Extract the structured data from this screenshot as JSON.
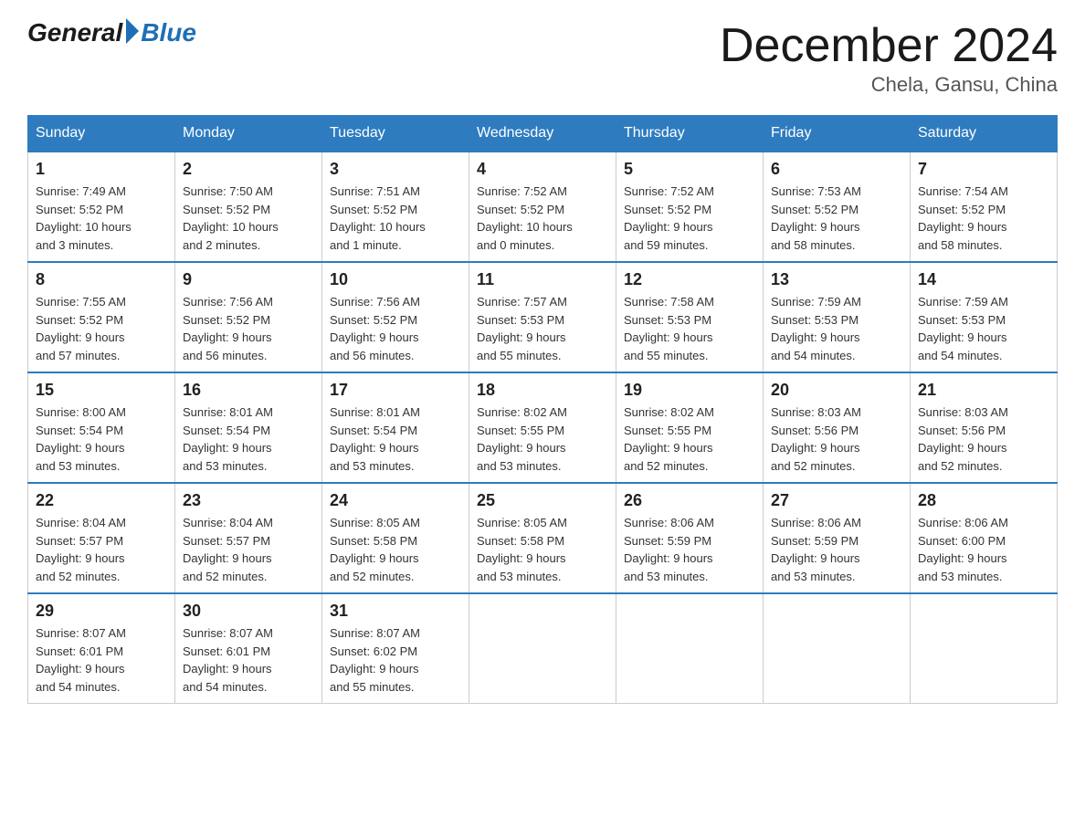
{
  "logo": {
    "general": "General",
    "blue": "Blue"
  },
  "title": "December 2024",
  "location": "Chela, Gansu, China",
  "weekdays": [
    "Sunday",
    "Monday",
    "Tuesday",
    "Wednesday",
    "Thursday",
    "Friday",
    "Saturday"
  ],
  "weeks": [
    [
      {
        "day": "1",
        "sunrise": "7:49 AM",
        "sunset": "5:52 PM",
        "daylight": "10 hours and 3 minutes."
      },
      {
        "day": "2",
        "sunrise": "7:50 AM",
        "sunset": "5:52 PM",
        "daylight": "10 hours and 2 minutes."
      },
      {
        "day": "3",
        "sunrise": "7:51 AM",
        "sunset": "5:52 PM",
        "daylight": "10 hours and 1 minute."
      },
      {
        "day": "4",
        "sunrise": "7:52 AM",
        "sunset": "5:52 PM",
        "daylight": "10 hours and 0 minutes."
      },
      {
        "day": "5",
        "sunrise": "7:52 AM",
        "sunset": "5:52 PM",
        "daylight": "9 hours and 59 minutes."
      },
      {
        "day": "6",
        "sunrise": "7:53 AM",
        "sunset": "5:52 PM",
        "daylight": "9 hours and 58 minutes."
      },
      {
        "day": "7",
        "sunrise": "7:54 AM",
        "sunset": "5:52 PM",
        "daylight": "9 hours and 58 minutes."
      }
    ],
    [
      {
        "day": "8",
        "sunrise": "7:55 AM",
        "sunset": "5:52 PM",
        "daylight": "9 hours and 57 minutes."
      },
      {
        "day": "9",
        "sunrise": "7:56 AM",
        "sunset": "5:52 PM",
        "daylight": "9 hours and 56 minutes."
      },
      {
        "day": "10",
        "sunrise": "7:56 AM",
        "sunset": "5:52 PM",
        "daylight": "9 hours and 56 minutes."
      },
      {
        "day": "11",
        "sunrise": "7:57 AM",
        "sunset": "5:53 PM",
        "daylight": "9 hours and 55 minutes."
      },
      {
        "day": "12",
        "sunrise": "7:58 AM",
        "sunset": "5:53 PM",
        "daylight": "9 hours and 55 minutes."
      },
      {
        "day": "13",
        "sunrise": "7:59 AM",
        "sunset": "5:53 PM",
        "daylight": "9 hours and 54 minutes."
      },
      {
        "day": "14",
        "sunrise": "7:59 AM",
        "sunset": "5:53 PM",
        "daylight": "9 hours and 54 minutes."
      }
    ],
    [
      {
        "day": "15",
        "sunrise": "8:00 AM",
        "sunset": "5:54 PM",
        "daylight": "9 hours and 53 minutes."
      },
      {
        "day": "16",
        "sunrise": "8:01 AM",
        "sunset": "5:54 PM",
        "daylight": "9 hours and 53 minutes."
      },
      {
        "day": "17",
        "sunrise": "8:01 AM",
        "sunset": "5:54 PM",
        "daylight": "9 hours and 53 minutes."
      },
      {
        "day": "18",
        "sunrise": "8:02 AM",
        "sunset": "5:55 PM",
        "daylight": "9 hours and 53 minutes."
      },
      {
        "day": "19",
        "sunrise": "8:02 AM",
        "sunset": "5:55 PM",
        "daylight": "9 hours and 52 minutes."
      },
      {
        "day": "20",
        "sunrise": "8:03 AM",
        "sunset": "5:56 PM",
        "daylight": "9 hours and 52 minutes."
      },
      {
        "day": "21",
        "sunrise": "8:03 AM",
        "sunset": "5:56 PM",
        "daylight": "9 hours and 52 minutes."
      }
    ],
    [
      {
        "day": "22",
        "sunrise": "8:04 AM",
        "sunset": "5:57 PM",
        "daylight": "9 hours and 52 minutes."
      },
      {
        "day": "23",
        "sunrise": "8:04 AM",
        "sunset": "5:57 PM",
        "daylight": "9 hours and 52 minutes."
      },
      {
        "day": "24",
        "sunrise": "8:05 AM",
        "sunset": "5:58 PM",
        "daylight": "9 hours and 52 minutes."
      },
      {
        "day": "25",
        "sunrise": "8:05 AM",
        "sunset": "5:58 PM",
        "daylight": "9 hours and 53 minutes."
      },
      {
        "day": "26",
        "sunrise": "8:06 AM",
        "sunset": "5:59 PM",
        "daylight": "9 hours and 53 minutes."
      },
      {
        "day": "27",
        "sunrise": "8:06 AM",
        "sunset": "5:59 PM",
        "daylight": "9 hours and 53 minutes."
      },
      {
        "day": "28",
        "sunrise": "8:06 AM",
        "sunset": "6:00 PM",
        "daylight": "9 hours and 53 minutes."
      }
    ],
    [
      {
        "day": "29",
        "sunrise": "8:07 AM",
        "sunset": "6:01 PM",
        "daylight": "9 hours and 54 minutes."
      },
      {
        "day": "30",
        "sunrise": "8:07 AM",
        "sunset": "6:01 PM",
        "daylight": "9 hours and 54 minutes."
      },
      {
        "day": "31",
        "sunrise": "8:07 AM",
        "sunset": "6:02 PM",
        "daylight": "9 hours and 55 minutes."
      },
      null,
      null,
      null,
      null
    ]
  ],
  "labels": {
    "sunrise": "Sunrise:",
    "sunset": "Sunset:",
    "daylight": "Daylight:"
  }
}
